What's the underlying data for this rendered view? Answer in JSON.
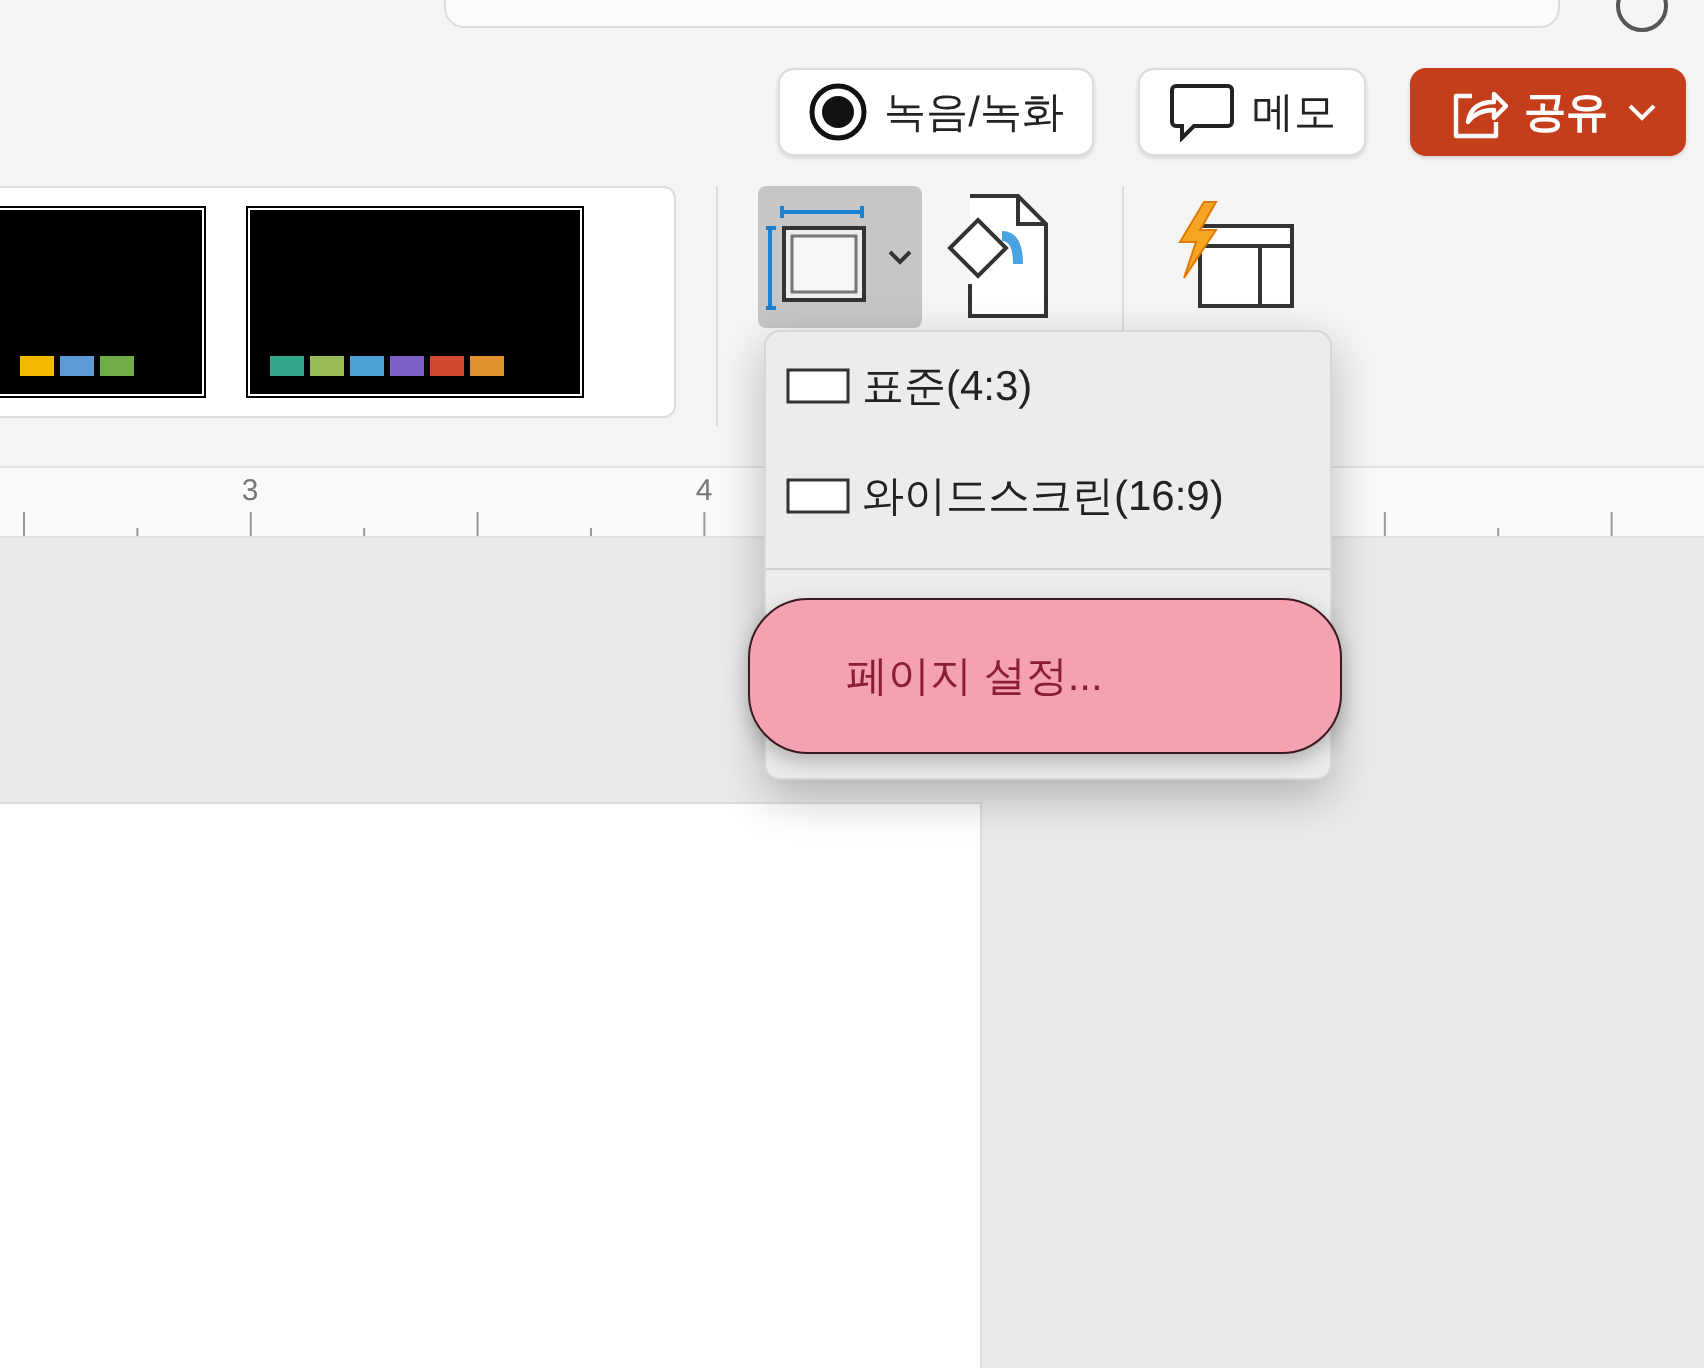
{
  "toolbar_buttons": [
    {
      "kind": "record",
      "label": "녹음/녹화"
    },
    {
      "kind": "comment",
      "label": "메모"
    },
    {
      "kind": "share",
      "label": "공유"
    }
  ],
  "theme_gallery": {
    "themes": [
      {
        "swatches": [
          {
            "color": "#f5b800"
          },
          {
            "color": "#5b9bd5"
          },
          {
            "color": "#70ad47"
          }
        ]
      },
      {
        "swatches": [
          {
            "color": "#2fa58a"
          },
          {
            "color": "#9bbb59"
          },
          {
            "color": "#4aa0d5"
          },
          {
            "color": "#7f5fc8"
          },
          {
            "color": "#d0482f"
          },
          {
            "color": "#e0902f"
          }
        ]
      }
    ]
  },
  "ribbon_tools": [
    {
      "kind": "slide-size",
      "selected": true
    },
    {
      "kind": "format-background",
      "selected": false
    },
    {
      "kind": "designer",
      "selected": false
    }
  ],
  "ruler": {
    "marks": [
      "3",
      "4"
    ]
  },
  "size_menu": {
    "items": [
      {
        "kind": "option",
        "label": "표준(4:3)",
        "selected": false
      },
      {
        "kind": "option",
        "label": "와이드스크린(16:9)",
        "selected": false
      },
      {
        "kind": "action",
        "label": "페이지 설정...",
        "selected": true
      }
    ]
  }
}
